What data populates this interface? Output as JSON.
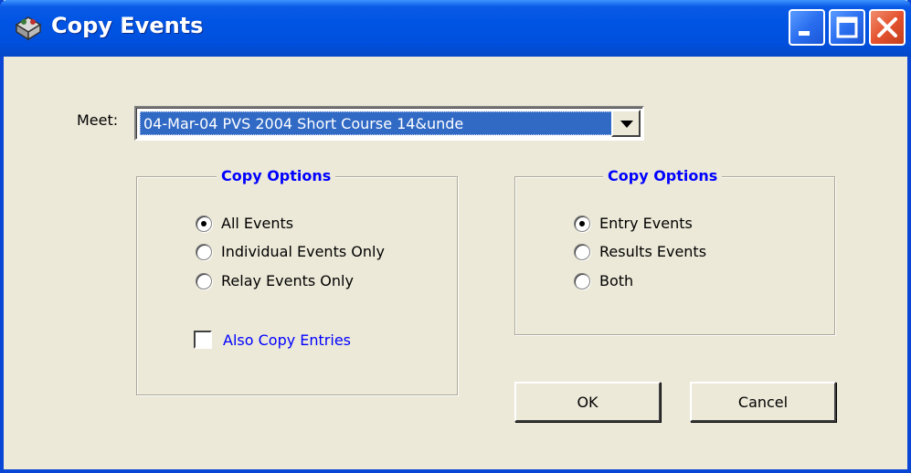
{
  "window": {
    "title": "Copy Events",
    "icons": {
      "app": "app-icon",
      "minimize": "minimize-icon",
      "maximize": "maximize-icon",
      "close": "close-icon"
    }
  },
  "meet": {
    "label": "Meet:",
    "selected": "04-Mar-04 PVS 2004 Short Course 14&unde"
  },
  "left_group": {
    "title": "Copy Options",
    "options": [
      {
        "label": "All Events",
        "checked": true
      },
      {
        "label": "Individual Events Only",
        "checked": false
      },
      {
        "label": "Relay Events Only",
        "checked": false
      }
    ],
    "also_copy_entries": {
      "label": "Also Copy Entries",
      "checked": false
    }
  },
  "right_group": {
    "title": "Copy Options",
    "options": [
      {
        "label": "Entry Events",
        "checked": true
      },
      {
        "label": "Results Events",
        "checked": false
      },
      {
        "label": "Both",
        "checked": false
      }
    ]
  },
  "buttons": {
    "ok": "OK",
    "cancel": "Cancel"
  },
  "colors": {
    "titlebar": "#0054e3",
    "accent_text": "#0000ff",
    "selection": "#316ac5",
    "dialog_bg": "#ece9d8"
  }
}
